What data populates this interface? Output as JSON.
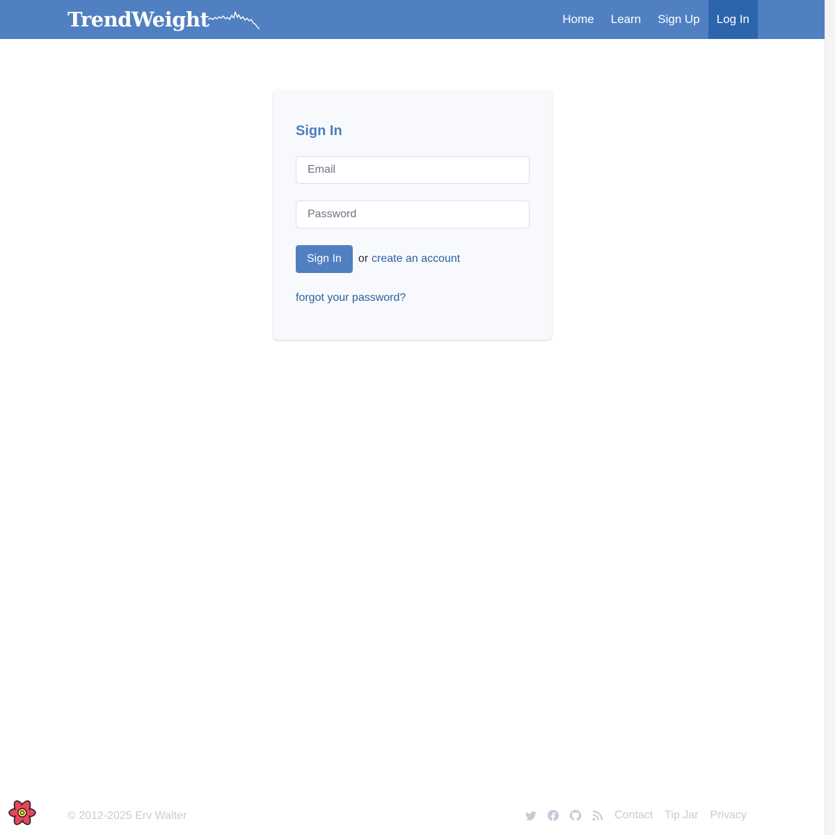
{
  "header": {
    "brand": "TrendWeight",
    "nav": [
      {
        "label": "Home",
        "active": false
      },
      {
        "label": "Learn",
        "active": false
      },
      {
        "label": "Sign Up",
        "active": false
      },
      {
        "label": "Log In",
        "active": true
      }
    ]
  },
  "signin": {
    "title": "Sign In",
    "email_placeholder": "Email",
    "email_value": "",
    "password_placeholder": "Password",
    "password_value": "",
    "submit_label": "Sign In",
    "or_text": "or",
    "create_account_label": "create an account",
    "forgot_label": "forgot your password?"
  },
  "footer": {
    "copyright": "© 2012-2025 Erv Walter",
    "social_icons": [
      "twitter-icon",
      "facebook-icon",
      "github-icon",
      "rss-icon"
    ],
    "links": [
      {
        "label": "Contact"
      },
      {
        "label": "Tip Jar"
      },
      {
        "label": "Privacy"
      }
    ]
  },
  "colors": {
    "header_bg": "#5080c1",
    "active_nav_bg": "#2d65ad",
    "title": "#4a7fbd",
    "link": "#2b5f9e",
    "footer_text": "#c3ccd8",
    "card_bg": "#f8f9fc"
  },
  "devtools": {
    "icon": "react-devtools-icon"
  }
}
